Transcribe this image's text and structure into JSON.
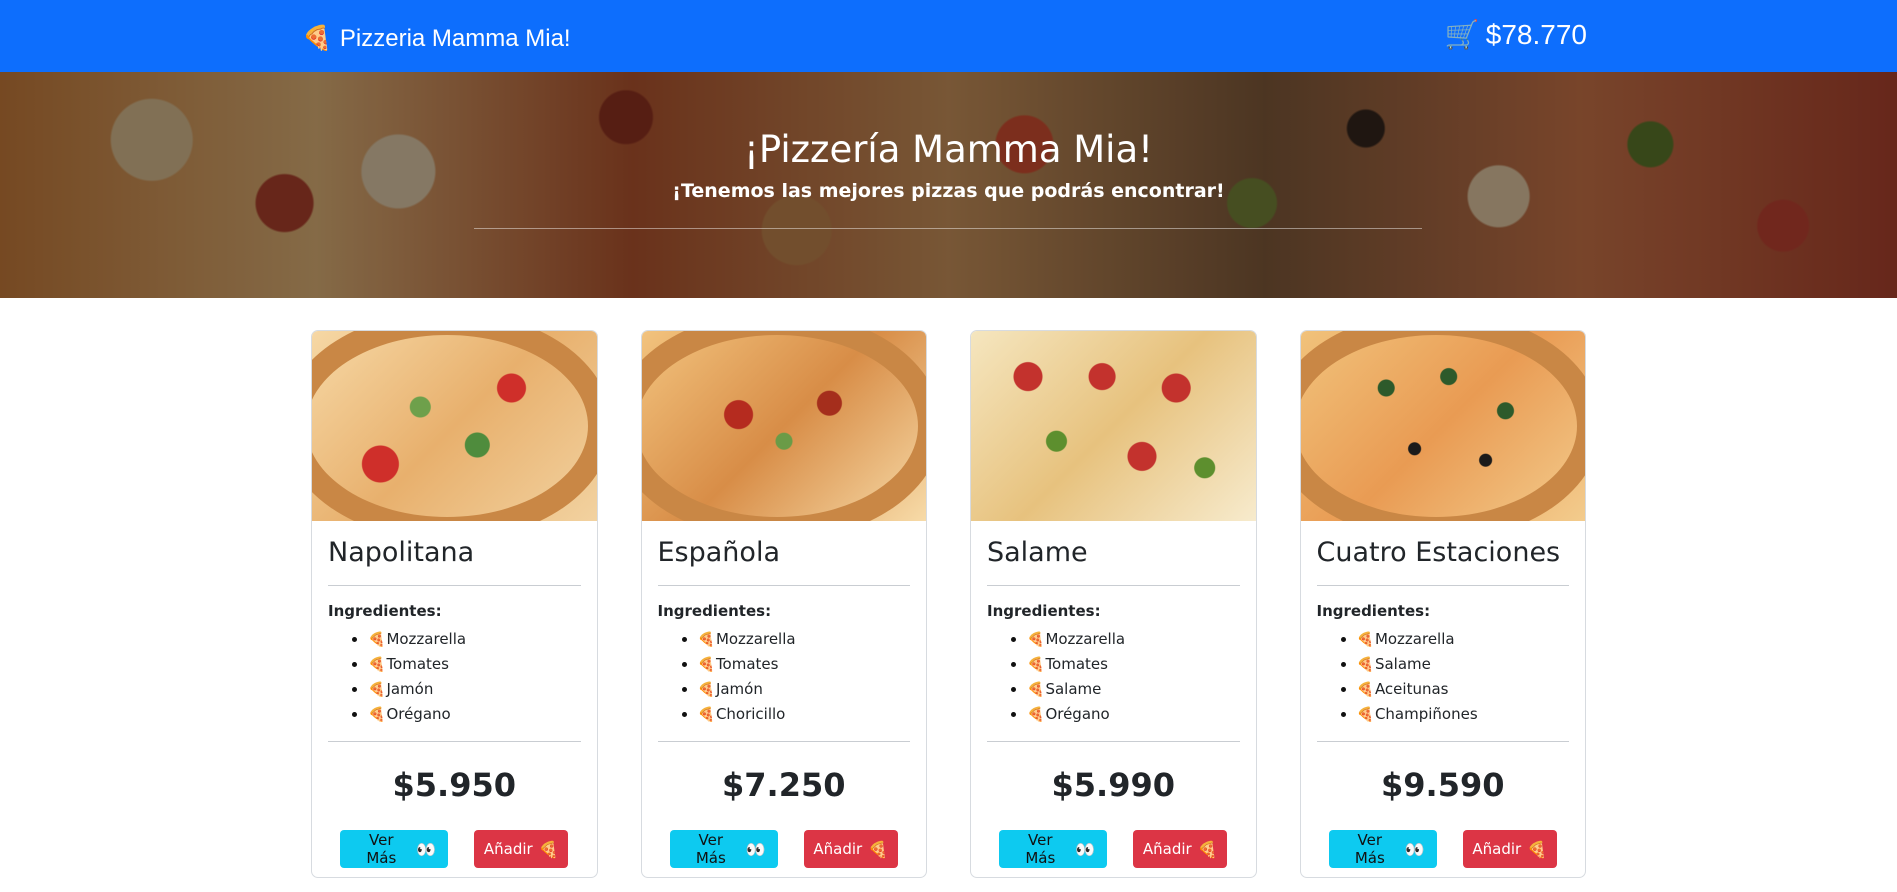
{
  "navbar": {
    "brand_icon": "🍕",
    "brand": "Pizzeria Mamma Mia!",
    "cart_icon": "🛒",
    "cart_total": "$78.770"
  },
  "hero": {
    "title": "¡Pizzería Mamma Mia!",
    "subtitle": "¡Tenemos las mejores pizzas que podrás encontrar!"
  },
  "common": {
    "ingredients_label": "Ingredientes:",
    "slice_icon": "🍕",
    "ver_mas": "Ver Más",
    "ver_mas_icon": "👀",
    "anadir": "Añadir",
    "anadir_icon": "🍕"
  },
  "pizzas": [
    {
      "name": "Napolitana",
      "ingredients": [
        "Mozzarella",
        "Tomates",
        "Jamón",
        "Orégano"
      ],
      "price": "$5.950"
    },
    {
      "name": "Española",
      "ingredients": [
        "Mozzarella",
        "Tomates",
        "Jamón",
        "Choricillo"
      ],
      "price": "$7.250"
    },
    {
      "name": "Salame",
      "ingredients": [
        "Mozzarella",
        "Tomates",
        "Salame",
        "Orégano"
      ],
      "price": "$5.990"
    },
    {
      "name": "Cuatro Estaciones",
      "ingredients": [
        "Mozzarella",
        "Salame",
        "Aceitunas",
        "Champiñones"
      ],
      "price": "$9.590"
    }
  ]
}
